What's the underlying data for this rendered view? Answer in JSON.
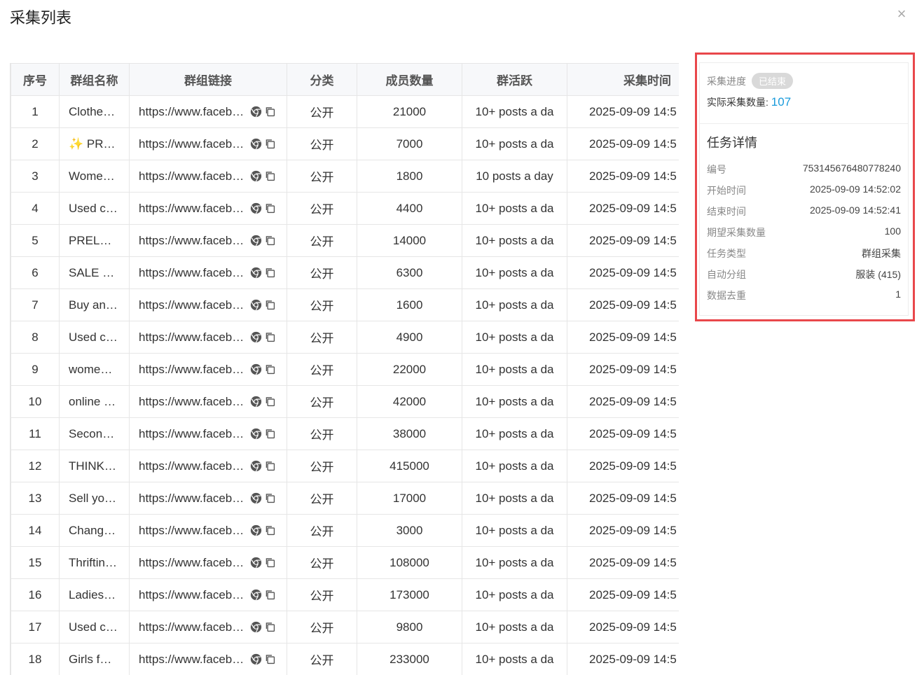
{
  "dialog": {
    "title": "采集列表",
    "close": "×"
  },
  "table": {
    "headers": {
      "index": "序号",
      "name": "群组名称",
      "link": "群组链接",
      "category": "分类",
      "members": "成员数量",
      "activity": "群活跃",
      "time": "采集时间"
    },
    "rows": [
      {
        "index": "1",
        "name": "Clothe…",
        "link": "https://www.faceb…",
        "category": "公开",
        "members": "21000",
        "activity": "10+ posts a da",
        "time": "2025-09-09 14:5"
      },
      {
        "index": "2",
        "name": "✨ PR…",
        "link": "https://www.faceb…",
        "category": "公开",
        "members": "7000",
        "activity": "10+ posts a da",
        "time": "2025-09-09 14:5"
      },
      {
        "index": "3",
        "name": "Wome…",
        "link": "https://www.faceb…",
        "category": "公开",
        "members": "1800",
        "activity": "10 posts a day",
        "time": "2025-09-09 14:5"
      },
      {
        "index": "4",
        "name": "Used c…",
        "link": "https://www.faceb…",
        "category": "公开",
        "members": "4400",
        "activity": "10+ posts a da",
        "time": "2025-09-09 14:5"
      },
      {
        "index": "5",
        "name": "PREL…",
        "link": "https://www.faceb…",
        "category": "公开",
        "members": "14000",
        "activity": "10+ posts a da",
        "time": "2025-09-09 14:5"
      },
      {
        "index": "6",
        "name": "SALE …",
        "link": "https://www.faceb…",
        "category": "公开",
        "members": "6300",
        "activity": "10+ posts a da",
        "time": "2025-09-09 14:5"
      },
      {
        "index": "7",
        "name": "Buy an…",
        "link": "https://www.faceb…",
        "category": "公开",
        "members": "1600",
        "activity": "10+ posts a da",
        "time": "2025-09-09 14:5"
      },
      {
        "index": "8",
        "name": "Used c…",
        "link": "https://www.faceb…",
        "category": "公开",
        "members": "4900",
        "activity": "10+ posts a da",
        "time": "2025-09-09 14:5"
      },
      {
        "index": "9",
        "name": "wome…",
        "link": "https://www.faceb…",
        "category": "公开",
        "members": "22000",
        "activity": "10+ posts a da",
        "time": "2025-09-09 14:5"
      },
      {
        "index": "10",
        "name": "online …",
        "link": "https://www.faceb…",
        "category": "公开",
        "members": "42000",
        "activity": "10+ posts a da",
        "time": "2025-09-09 14:5"
      },
      {
        "index": "11",
        "name": "Secon…",
        "link": "https://www.faceb…",
        "category": "公开",
        "members": "38000",
        "activity": "10+ posts a da",
        "time": "2025-09-09 14:5"
      },
      {
        "index": "12",
        "name": "THINK…",
        "link": "https://www.faceb…",
        "category": "公开",
        "members": "415000",
        "activity": "10+ posts a da",
        "time": "2025-09-09 14:5"
      },
      {
        "index": "13",
        "name": "Sell yo…",
        "link": "https://www.faceb…",
        "category": "公开",
        "members": "17000",
        "activity": "10+ posts a da",
        "time": "2025-09-09 14:5"
      },
      {
        "index": "14",
        "name": "Chang…",
        "link": "https://www.faceb…",
        "category": "公开",
        "members": "3000",
        "activity": "10+ posts a da",
        "time": "2025-09-09 14:5"
      },
      {
        "index": "15",
        "name": "Thriftin…",
        "link": "https://www.faceb…",
        "category": "公开",
        "members": "108000",
        "activity": "10+ posts a da",
        "time": "2025-09-09 14:5"
      },
      {
        "index": "16",
        "name": "Ladies…",
        "link": "https://www.faceb…",
        "category": "公开",
        "members": "173000",
        "activity": "10+ posts a da",
        "time": "2025-09-09 14:5"
      },
      {
        "index": "17",
        "name": "Used c…",
        "link": "https://www.faceb…",
        "category": "公开",
        "members": "9800",
        "activity": "10+ posts a da",
        "time": "2025-09-09 14:5"
      },
      {
        "index": "18",
        "name": "Girls f…",
        "link": "https://www.faceb…",
        "category": "公开",
        "members": "233000",
        "activity": "10+ posts a da",
        "time": "2025-09-09 14:5"
      }
    ]
  },
  "panel": {
    "progress_label": "采集进度",
    "status": "已结束",
    "count_label": "实际采集数量:",
    "count_value": "107",
    "detail_title": "任务详情",
    "details": [
      {
        "k": "编号",
        "v": "753145676480778240"
      },
      {
        "k": "开始时间",
        "v": "2025-09-09 14:52:02"
      },
      {
        "k": "结束时间",
        "v": "2025-09-09 14:52:41"
      },
      {
        "k": "期望采集数量",
        "v": "100"
      },
      {
        "k": "任务类型",
        "v": "群组采集"
      },
      {
        "k": "自动分组",
        "v": "服装 (415)"
      },
      {
        "k": "数据去重",
        "v": "1"
      }
    ]
  },
  "colors": {
    "highlight": "#e9474b",
    "accent": "#1a9bdb",
    "badge": "#d9d9d9"
  },
  "icons": [
    "close-icon",
    "chrome-icon",
    "copy-icon"
  ]
}
